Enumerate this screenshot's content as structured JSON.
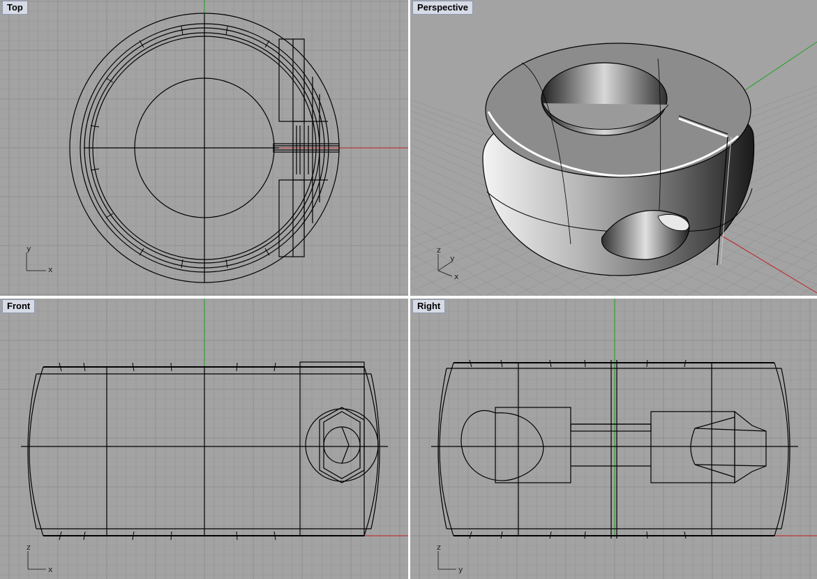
{
  "viewports": {
    "top": {
      "title": "Top",
      "axis": [
        "y",
        "x"
      ]
    },
    "perspective": {
      "title": "Perspective",
      "axis": [
        "z",
        "y",
        "x"
      ]
    },
    "front": {
      "title": "Front",
      "axis": [
        "z",
        "x"
      ]
    },
    "right": {
      "title": "Right",
      "axis": [
        "z",
        "y"
      ]
    }
  },
  "colors": {
    "viewport_bg": "#a3a3a3",
    "grid_line": "#939393",
    "x_axis": "#c02020",
    "y_axis": "#20a020",
    "wire": "#000000",
    "title_tab": "#d6dbe6"
  }
}
